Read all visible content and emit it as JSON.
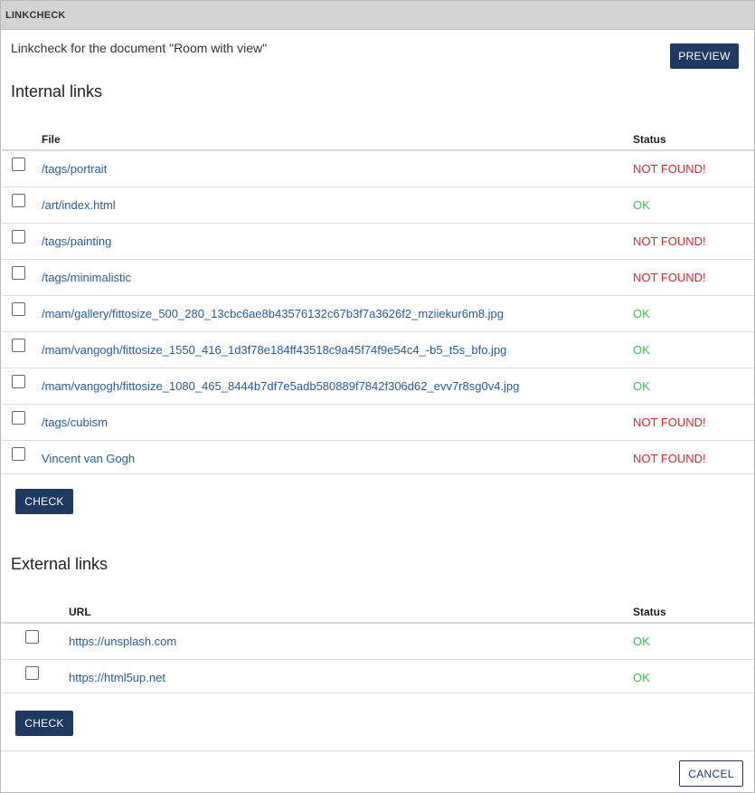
{
  "window": {
    "title": "LINKCHECK"
  },
  "intro_text": "Linkcheck for the document \"Room with view\"",
  "buttons": {
    "preview": "PREVIEW",
    "check": "CHECK",
    "cancel": "CANCEL"
  },
  "internal": {
    "heading": "Internal links",
    "columns": {
      "file": "File",
      "status": "Status"
    },
    "rows": [
      {
        "file": "/tags/portrait",
        "status": "NOT FOUND!",
        "ok": false
      },
      {
        "file": "/art/index.html",
        "status": "OK",
        "ok": true
      },
      {
        "file": "/tags/painting",
        "status": "NOT FOUND!",
        "ok": false
      },
      {
        "file": "/tags/minimalistic",
        "status": "NOT FOUND!",
        "ok": false
      },
      {
        "file": "/mam/gallery/fittosize_500_280_13cbc6ae8b43576132c67b3f7a3626f2_mziiekur6m8.jpg",
        "status": "OK",
        "ok": true
      },
      {
        "file": "/mam/vangogh/fittosize_1550_416_1d3f78e184ff43518c9a45f74f9e54c4_-b5_t5s_bfo.jpg",
        "status": "OK",
        "ok": true
      },
      {
        "file": "/mam/vangogh/fittosize_1080_465_8444b7df7e5adb580889f7842f306d62_evv7r8sg0v4.jpg",
        "status": "OK",
        "ok": true
      },
      {
        "file": "/tags/cubism",
        "status": "NOT FOUND!",
        "ok": false
      },
      {
        "file": "Vincent van Gogh",
        "status": "NOT FOUND!",
        "ok": false
      }
    ]
  },
  "external": {
    "heading": "External links",
    "columns": {
      "url": "URL",
      "status": "Status"
    },
    "rows": [
      {
        "url": "https://unsplash.com",
        "status": "OK",
        "ok": true
      },
      {
        "url": "https://html5up.net",
        "status": "OK",
        "ok": true
      }
    ]
  },
  "colors": {
    "primary": "#1f3a60",
    "ok": "#3dba4e",
    "not_found": "#d8262b",
    "link": "#2a5a99"
  }
}
